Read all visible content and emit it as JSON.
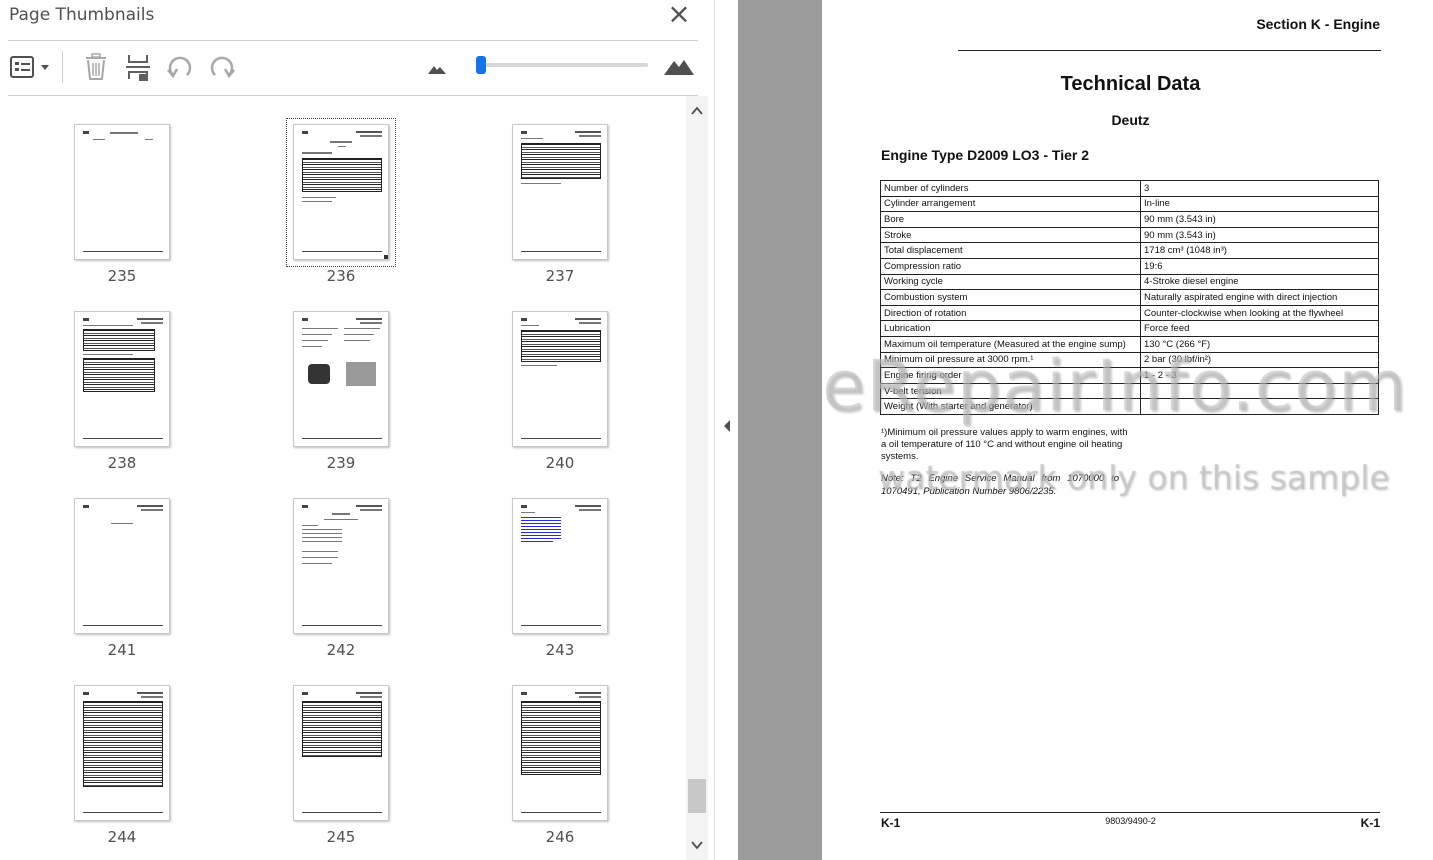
{
  "sidebar": {
    "title": "Page Thumbnails",
    "close_icon": "close-icon",
    "toolbar": {
      "options_icon": "thumbnail-options-icon",
      "delete_icon": "trash-icon",
      "insert_icon": "insert-pages-icon",
      "rotate_ccw_icon": "rotate-counterclockwise-icon",
      "rotate_cw_icon": "rotate-clockwise-icon",
      "zoom_out_icon": "small-mountain-icon",
      "zoom_in_icon": "large-mountain-icon",
      "zoom_level_fraction": 0.03
    },
    "thumbnails": [
      {
        "page": "235"
      },
      {
        "page": "236"
      },
      {
        "page": "237"
      },
      {
        "page": "238"
      },
      {
        "page": "239"
      },
      {
        "page": "240"
      },
      {
        "page": "241"
      },
      {
        "page": "242"
      },
      {
        "page": "243"
      },
      {
        "page": "244"
      },
      {
        "page": "245"
      },
      {
        "page": "246"
      }
    ],
    "selected_page": "236",
    "accent_color": "#1473e6"
  },
  "document": {
    "section_header": "Section K - Engine",
    "title": "Technical Data",
    "manufacturer": "Deutz",
    "engine_title": "Engine Type D2009 LO3 - Tier 2",
    "specs": [
      {
        "label": "Number of cylinders",
        "value": "3"
      },
      {
        "label": "Cylinder arrangement",
        "value": "In-line"
      },
      {
        "label": "Bore",
        "value": "90 mm (3.543 in)"
      },
      {
        "label": "Stroke",
        "value": "90 mm (3.543 in)"
      },
      {
        "label": "Total displacement",
        "value": "1718 cm³ (1048 in³)"
      },
      {
        "label": "Compression ratio",
        "value": "19:6"
      },
      {
        "label": "Working cycle",
        "value": "4-Stroke diesel engine"
      },
      {
        "label": "Combustion system",
        "value": "Naturally aspirated engine with direct injection"
      },
      {
        "label": "Direction of rotation",
        "value": "Counter-clockwise when looking at the flywheel"
      },
      {
        "label": "Lubrication",
        "value": "Force feed"
      },
      {
        "label": "Maximum oil temperature (Measured at the engine sump)",
        "value": "130 °C (266 °F)"
      },
      {
        "label": "Minimum oil pressure at 3000 rpm.¹",
        "value": "2 bar (30 lbf/in²)"
      },
      {
        "label": "Engine firing order",
        "value": "1 - 2 - 3"
      },
      {
        "label": "V-belt tension",
        "value": ""
      },
      {
        "label": "Weight (With starter and generator)",
        "value": ""
      }
    ],
    "footnote": "¹)Minimum oil pressure values apply to warm engines, with a oil temperature of 110 °C and without engine oil heating systems.",
    "note": "Note: T2 Engine Service Manual from 1070000 to 1070491, Publication Number 9806/2235.",
    "watermark_main": "eRepairInfo.com",
    "watermark_sub": "watermark only on this sample",
    "footer_left": "K-1",
    "footer_center": "9803/9490-2",
    "footer_right": "K-1"
  }
}
